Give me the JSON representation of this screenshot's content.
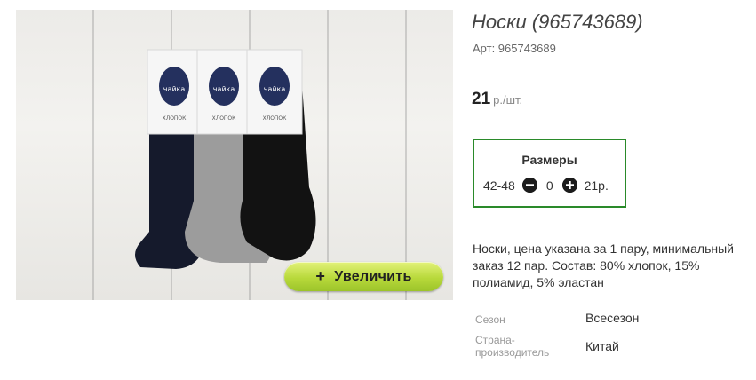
{
  "product": {
    "title": "Носки (965743689)",
    "sku_label": "Арт: 965743689",
    "price_value": "21",
    "price_unit": "р./шт.",
    "description": "Носки, цена указана за 1 пару, минимальный заказ 12 пар. Состав: 80% хлопок, 15% полиамид, 5% эластан"
  },
  "image": {
    "zoom_plus": "+",
    "zoom_label": "Увеличить",
    "brand_text": "чайка",
    "label_text": "ХЛОПОК"
  },
  "sizes": {
    "heading": "Размеры",
    "rows": [
      {
        "size": "42-48",
        "quantity": "0",
        "price": "21р."
      }
    ],
    "minus_icon": "minus-circle-icon",
    "plus_icon": "plus-circle-icon"
  },
  "properties": [
    {
      "key": "Сезон",
      "value": "Всесезон"
    },
    {
      "key": "Страна-производитель",
      "value": "Китай"
    }
  ],
  "colors": {
    "sizes_border": "#2a8a2a",
    "zoom_button": "#b8d93b"
  }
}
